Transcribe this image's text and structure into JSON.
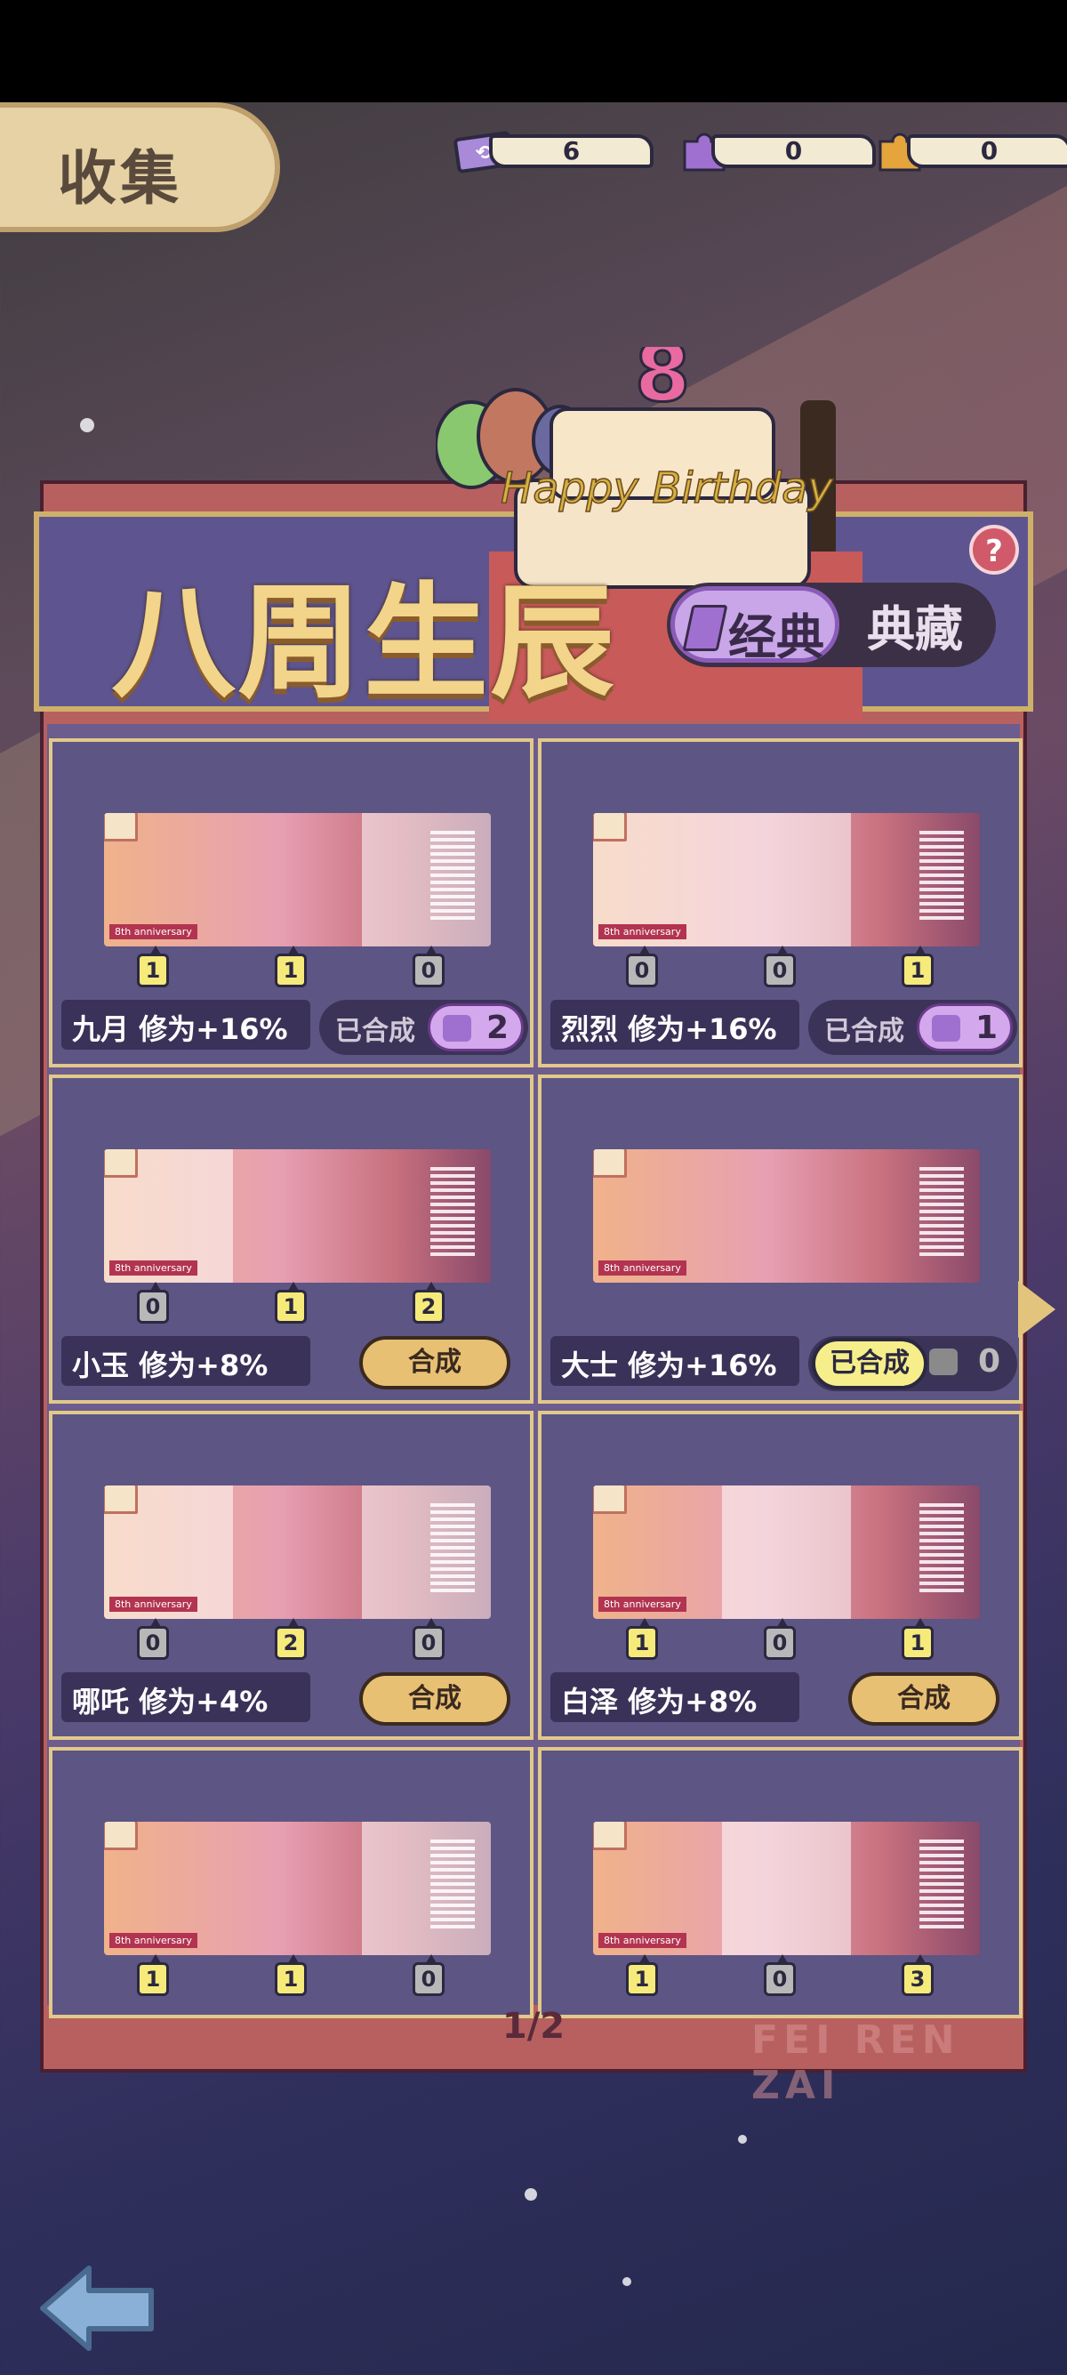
{
  "header": {
    "collect_label": "收集"
  },
  "resources": [
    {
      "icon": "ticket-icon",
      "value": "6"
    },
    {
      "icon": "purple-puzzle-icon",
      "value": "0"
    },
    {
      "icon": "orange-puzzle-icon",
      "value": "0"
    }
  ],
  "banner": {
    "title": "八周生辰",
    "cake_text": "Happy Birthday",
    "cake_number": "8",
    "help": "?"
  },
  "toggle": {
    "active": "经典",
    "inactive": "典藏"
  },
  "cards": [
    {
      "name": "九月  修为+16%",
      "frags": [
        "1",
        "1",
        "0"
      ],
      "status": "done",
      "done_label": "已合成",
      "count": "2"
    },
    {
      "name": "烈烈  修为+16%",
      "frags": [
        "0",
        "0",
        "1"
      ],
      "status": "done",
      "done_label": "已合成",
      "count": "1"
    },
    {
      "name": "小玉  修为+8%",
      "frags": [
        "0",
        "1",
        "2"
      ],
      "status": "combine",
      "combine_label": "合成"
    },
    {
      "name": "大士  修为+16%",
      "frags": [],
      "status": "done-hi",
      "done_label": "已合成",
      "count": "0"
    },
    {
      "name": "哪吒  修为+4%",
      "frags": [
        "0",
        "2",
        "0"
      ],
      "status": "combine",
      "combine_label": "合成"
    },
    {
      "name": "白泽  修为+8%",
      "frags": [
        "1",
        "0",
        "1"
      ],
      "status": "combine",
      "combine_label": "合成"
    },
    {
      "name": "",
      "frags": [
        "1",
        "1",
        "0"
      ],
      "status": "partial"
    },
    {
      "name": "",
      "frags": [
        "1",
        "0",
        "3"
      ],
      "status": "partial"
    }
  ],
  "art_label": "8th anniversary",
  "pagination": {
    "label": "1/2"
  },
  "brand": "FEI REN ZAI",
  "colors": {
    "accent": "#e8c073",
    "panel": "#5d5584",
    "gold": "#f2d48a"
  }
}
